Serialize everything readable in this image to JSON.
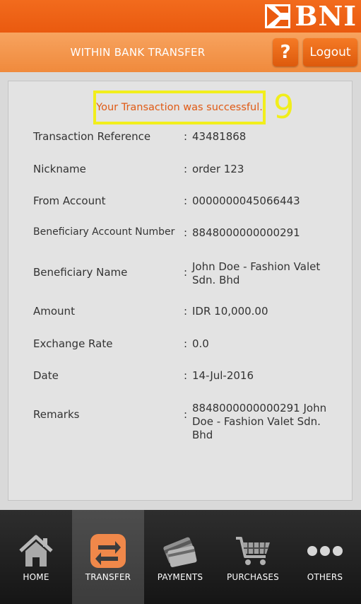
{
  "brand": {
    "name": "BNI",
    "logo_icon": "bni-logo-icon"
  },
  "header": {
    "title": "WITHIN BANK TRANSFER",
    "help_label": "?",
    "logout_label": "Logout"
  },
  "receipt": {
    "success_message": "Your Transaction was successful.",
    "step_number": "9",
    "separator": ":",
    "fields": [
      {
        "label": "Transaction Reference",
        "value": "43481868"
      },
      {
        "label": "Nickname",
        "value": "order 123"
      },
      {
        "label": "From Account",
        "value": "0000000045066443"
      },
      {
        "label": "Beneficiary Account Number",
        "value": "8848000000000291"
      },
      {
        "label": "Beneficiary Name",
        "value": "John Doe - Fashion Valet Sdn. Bhd"
      },
      {
        "label": "Amount",
        "value": "IDR 10,000.00"
      },
      {
        "label": "Exchange Rate",
        "value": "0.0"
      },
      {
        "label": "Date",
        "value": "14-Jul-2016"
      },
      {
        "label": "Remarks",
        "value": "8848000000000291 John Doe - Fashion Valet Sdn. Bhd"
      }
    ]
  },
  "nav": {
    "items": [
      {
        "label": "HOME",
        "icon": "home-icon"
      },
      {
        "label": "TRANSFER",
        "icon": "transfer-icon",
        "active": true
      },
      {
        "label": "PAYMENTS",
        "icon": "payments-icon"
      },
      {
        "label": "PURCHASES",
        "icon": "purchases-icon"
      },
      {
        "label": "OTHERS",
        "icon": "others-icon"
      }
    ]
  },
  "colors": {
    "brand_orange": "#f26b1d",
    "highlight_yellow": "#f1ee1c",
    "success_text": "#e05a14",
    "active_icon_orange": "#f0884a"
  }
}
